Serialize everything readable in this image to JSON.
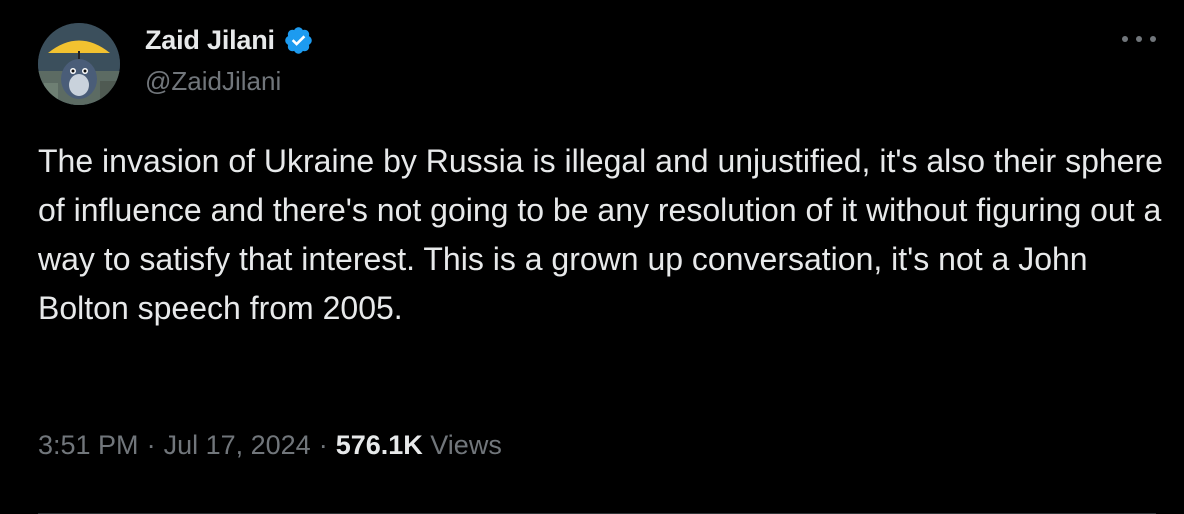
{
  "author": {
    "display_name": "Zaid Jilani",
    "handle": "@ZaidJilani",
    "verified": true,
    "verified_color": "#1d9bf0"
  },
  "tweet": {
    "text": "The invasion of Ukraine by Russia is illegal and unjustified, it's also their sphere of influence and there's not going to be any resolution of it without figuring out a way to satisfy that interest. This is a grown up conversation, it's not a John Bolton speech from 2005.",
    "time": "3:51 PM",
    "date": "Jul 17, 2024",
    "separator": "·",
    "views_count": "576.1K",
    "views_label": "Views"
  },
  "icons": {
    "more": "more-horizontal-icon",
    "verified": "verified-badge-icon"
  },
  "colors": {
    "background": "#000000",
    "primary_text": "#e7e9ea",
    "secondary_text": "#71767b",
    "accent": "#1d9bf0"
  }
}
